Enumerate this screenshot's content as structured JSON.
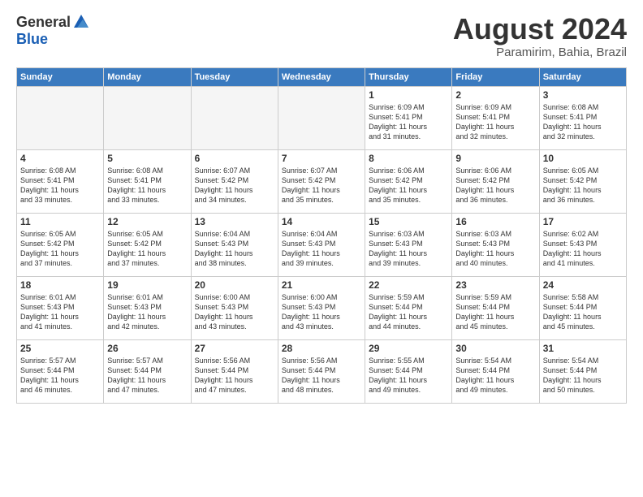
{
  "header": {
    "logo_general": "General",
    "logo_blue": "Blue",
    "month_title": "August 2024",
    "location": "Paramirim, Bahia, Brazil"
  },
  "days_of_week": [
    "Sunday",
    "Monday",
    "Tuesday",
    "Wednesday",
    "Thursday",
    "Friday",
    "Saturday"
  ],
  "weeks": [
    [
      {
        "day": "",
        "info": ""
      },
      {
        "day": "",
        "info": ""
      },
      {
        "day": "",
        "info": ""
      },
      {
        "day": "",
        "info": ""
      },
      {
        "day": "1",
        "info": "Sunrise: 6:09 AM\nSunset: 5:41 PM\nDaylight: 11 hours\nand 31 minutes."
      },
      {
        "day": "2",
        "info": "Sunrise: 6:09 AM\nSunset: 5:41 PM\nDaylight: 11 hours\nand 32 minutes."
      },
      {
        "day": "3",
        "info": "Sunrise: 6:08 AM\nSunset: 5:41 PM\nDaylight: 11 hours\nand 32 minutes."
      }
    ],
    [
      {
        "day": "4",
        "info": "Sunrise: 6:08 AM\nSunset: 5:41 PM\nDaylight: 11 hours\nand 33 minutes."
      },
      {
        "day": "5",
        "info": "Sunrise: 6:08 AM\nSunset: 5:41 PM\nDaylight: 11 hours\nand 33 minutes."
      },
      {
        "day": "6",
        "info": "Sunrise: 6:07 AM\nSunset: 5:42 PM\nDaylight: 11 hours\nand 34 minutes."
      },
      {
        "day": "7",
        "info": "Sunrise: 6:07 AM\nSunset: 5:42 PM\nDaylight: 11 hours\nand 35 minutes."
      },
      {
        "day": "8",
        "info": "Sunrise: 6:06 AM\nSunset: 5:42 PM\nDaylight: 11 hours\nand 35 minutes."
      },
      {
        "day": "9",
        "info": "Sunrise: 6:06 AM\nSunset: 5:42 PM\nDaylight: 11 hours\nand 36 minutes."
      },
      {
        "day": "10",
        "info": "Sunrise: 6:05 AM\nSunset: 5:42 PM\nDaylight: 11 hours\nand 36 minutes."
      }
    ],
    [
      {
        "day": "11",
        "info": "Sunrise: 6:05 AM\nSunset: 5:42 PM\nDaylight: 11 hours\nand 37 minutes."
      },
      {
        "day": "12",
        "info": "Sunrise: 6:05 AM\nSunset: 5:42 PM\nDaylight: 11 hours\nand 37 minutes."
      },
      {
        "day": "13",
        "info": "Sunrise: 6:04 AM\nSunset: 5:43 PM\nDaylight: 11 hours\nand 38 minutes."
      },
      {
        "day": "14",
        "info": "Sunrise: 6:04 AM\nSunset: 5:43 PM\nDaylight: 11 hours\nand 39 minutes."
      },
      {
        "day": "15",
        "info": "Sunrise: 6:03 AM\nSunset: 5:43 PM\nDaylight: 11 hours\nand 39 minutes."
      },
      {
        "day": "16",
        "info": "Sunrise: 6:03 AM\nSunset: 5:43 PM\nDaylight: 11 hours\nand 40 minutes."
      },
      {
        "day": "17",
        "info": "Sunrise: 6:02 AM\nSunset: 5:43 PM\nDaylight: 11 hours\nand 41 minutes."
      }
    ],
    [
      {
        "day": "18",
        "info": "Sunrise: 6:01 AM\nSunset: 5:43 PM\nDaylight: 11 hours\nand 41 minutes."
      },
      {
        "day": "19",
        "info": "Sunrise: 6:01 AM\nSunset: 5:43 PM\nDaylight: 11 hours\nand 42 minutes."
      },
      {
        "day": "20",
        "info": "Sunrise: 6:00 AM\nSunset: 5:43 PM\nDaylight: 11 hours\nand 43 minutes."
      },
      {
        "day": "21",
        "info": "Sunrise: 6:00 AM\nSunset: 5:43 PM\nDaylight: 11 hours\nand 43 minutes."
      },
      {
        "day": "22",
        "info": "Sunrise: 5:59 AM\nSunset: 5:44 PM\nDaylight: 11 hours\nand 44 minutes."
      },
      {
        "day": "23",
        "info": "Sunrise: 5:59 AM\nSunset: 5:44 PM\nDaylight: 11 hours\nand 45 minutes."
      },
      {
        "day": "24",
        "info": "Sunrise: 5:58 AM\nSunset: 5:44 PM\nDaylight: 11 hours\nand 45 minutes."
      }
    ],
    [
      {
        "day": "25",
        "info": "Sunrise: 5:57 AM\nSunset: 5:44 PM\nDaylight: 11 hours\nand 46 minutes."
      },
      {
        "day": "26",
        "info": "Sunrise: 5:57 AM\nSunset: 5:44 PM\nDaylight: 11 hours\nand 47 minutes."
      },
      {
        "day": "27",
        "info": "Sunrise: 5:56 AM\nSunset: 5:44 PM\nDaylight: 11 hours\nand 47 minutes."
      },
      {
        "day": "28",
        "info": "Sunrise: 5:56 AM\nSunset: 5:44 PM\nDaylight: 11 hours\nand 48 minutes."
      },
      {
        "day": "29",
        "info": "Sunrise: 5:55 AM\nSunset: 5:44 PM\nDaylight: 11 hours\nand 49 minutes."
      },
      {
        "day": "30",
        "info": "Sunrise: 5:54 AM\nSunset: 5:44 PM\nDaylight: 11 hours\nand 49 minutes."
      },
      {
        "day": "31",
        "info": "Sunrise: 5:54 AM\nSunset: 5:44 PM\nDaylight: 11 hours\nand 50 minutes."
      }
    ]
  ]
}
